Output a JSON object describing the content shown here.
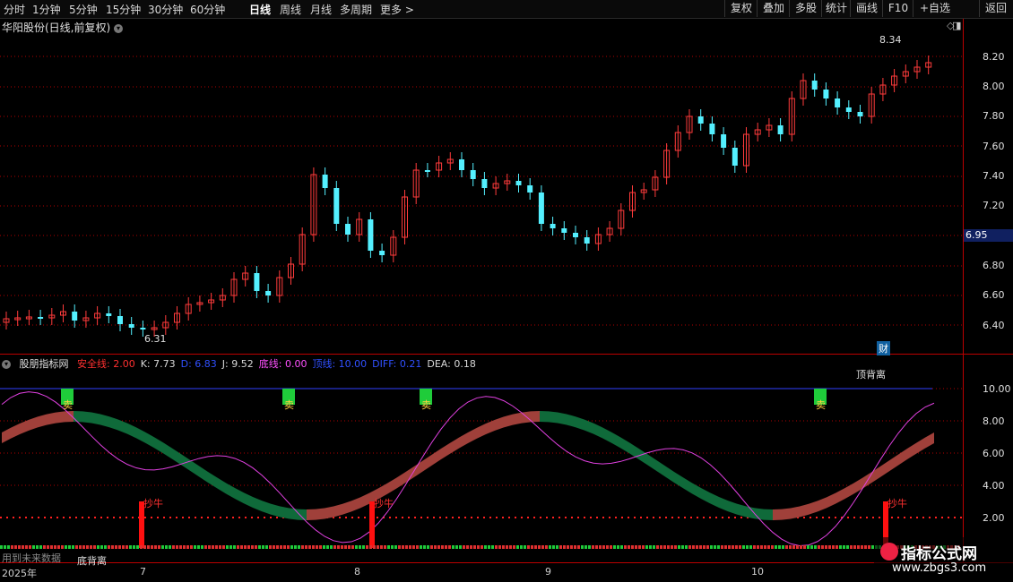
{
  "toolbar": {
    "periods": [
      "分时",
      "1分钟",
      "5分钟",
      "15分钟",
      "30分钟",
      "60分钟",
      "日线",
      "周线",
      "月线",
      "多周期",
      "更多 >"
    ],
    "active_period": "日线",
    "right_buttons": [
      "复权",
      "叠加",
      "多股",
      "统计",
      "画线",
      "F10",
      "+自选",
      "返回"
    ]
  },
  "stock": {
    "title": "华阳股份(日线,前复权)",
    "current_price": "6.95"
  },
  "price_axis": {
    "ticks": [
      "8.20",
      "8.00",
      "7.80",
      "7.60",
      "7.40",
      "7.20",
      "6.80",
      "6.60",
      "6.40"
    ]
  },
  "annotations": {
    "high": "8.34",
    "low": "6.31",
    "cai_badge": "财",
    "bottom_divergence": "底背离",
    "top_divergence": "顶背离",
    "future_data": "用到未来数据"
  },
  "indicator": {
    "name": "股朋指标网",
    "values": [
      {
        "label": "安全线:",
        "value": "2.00",
        "color": "#ff3030"
      },
      {
        "label": "K:",
        "value": "7.73",
        "color": "#d8d8d8"
      },
      {
        "label": "D:",
        "value": "6.83",
        "color": "#3050ff"
      },
      {
        "label": "J:",
        "value": "9.52",
        "color": "#d8d8d8"
      },
      {
        "label": "底线:",
        "value": "0.00",
        "color": "#ff50ff"
      },
      {
        "label": "顶线:",
        "value": "10.00",
        "color": "#3050ff"
      },
      {
        "label": "DIFF:",
        "value": "0.21",
        "color": "#3050ff"
      },
      {
        "label": "DEA:",
        "value": "0.18",
        "color": "#d8d8d8"
      }
    ],
    "ticks": [
      "10.00",
      "8.00",
      "6.00",
      "4.00",
      "2.00"
    ],
    "sell_label": "卖",
    "buy_label": "抄牛"
  },
  "xaxis": {
    "labels": [
      "2025年",
      "7",
      "8",
      "9",
      "10"
    ]
  },
  "watermark": {
    "name": "指标公式网",
    "url": "www.zbgs3.com"
  },
  "colors": {
    "up": "#ff3b3b",
    "down": "#54f0ff",
    "grid": "#b00000"
  }
}
